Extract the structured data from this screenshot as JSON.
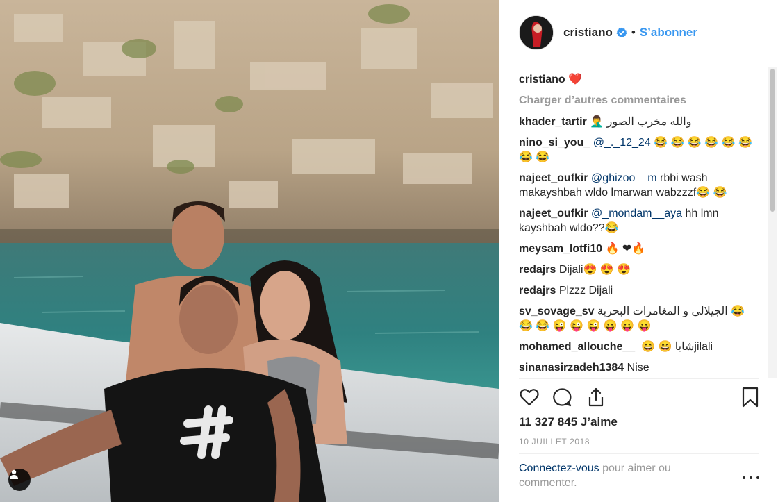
{
  "post": {
    "author": "cristiano",
    "follow_label": "S’abonner",
    "separator": "•",
    "caption_text": "❤️",
    "load_more": "Charger d’autres commentaires",
    "likes": "11 327 845 J’aime",
    "date": "10 JUILLET 2018",
    "login_link": "Connectez-vous",
    "login_rest": " pour aimer ou commenter."
  },
  "comments": [
    {
      "user": "khader_tartir",
      "parts": [
        {
          "t": "والله مخرب الصور 🤦‍♂️",
          "rtl": true
        }
      ]
    },
    {
      "user": "nino_si_you_",
      "parts": [
        {
          "t": "@_._12_24",
          "mention": true
        },
        {
          "t": " 😂 😂 😂 😂 😂 😂 😂 😂"
        }
      ]
    },
    {
      "user": "najeet_oufkir",
      "parts": [
        {
          "t": "@ghizoo__m",
          "mention": true
        },
        {
          "t": " rbbi wash makayshbah wldo lmarwan wabzzzf😂 😂"
        }
      ]
    },
    {
      "user": "najeet_oufkir",
      "parts": [
        {
          "t": "@_mondam__aya",
          "mention": true
        },
        {
          "t": " hh lmn kayshbah wldo??😂"
        }
      ]
    },
    {
      "user": "meysam_lotfi10",
      "parts": [
        {
          "t": "🔥 ❤🔥"
        }
      ]
    },
    {
      "user": "redajrs",
      "parts": [
        {
          "t": "Dijali😍 😍 😍"
        }
      ]
    },
    {
      "user": "redajrs",
      "parts": [
        {
          "t": "Plzzz Dijali"
        }
      ]
    },
    {
      "user": "sv_sovage_sv",
      "parts": [
        {
          "t": "الجيلالي و المغامرات البحرية",
          "rtl": true
        },
        {
          "t": " 😂 😂 😂 😜 😜 😜 😛 😛 😛"
        }
      ]
    },
    {
      "user": "mohamed_allouche__",
      "parts": [
        {
          "t": "شابا 😄 😄 ",
          "rtl": true
        },
        {
          "t": "jilali"
        }
      ]
    },
    {
      "user": "sinanasirzadeh1384",
      "parts": [
        {
          "t": "Nise"
        }
      ]
    }
  ],
  "icons": {
    "like": "heart-icon",
    "comment": "comment-bubble-icon",
    "share": "share-icon",
    "save": "bookmark-icon",
    "verified": "verified-badge-icon",
    "more": "more-options-icon",
    "user_tag": "user-tag-icon"
  },
  "colors": {
    "link_blue": "#3897f0",
    "mention_blue": "#003569",
    "muted_gray": "#999999",
    "text_dark": "#262626"
  }
}
